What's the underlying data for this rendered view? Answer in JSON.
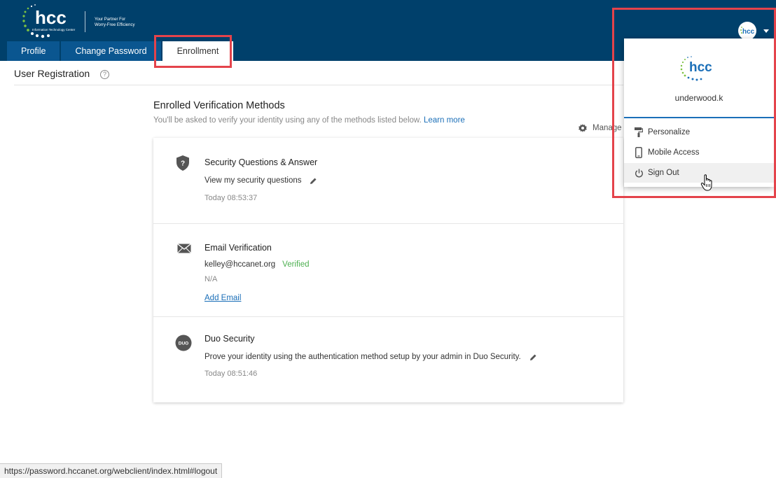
{
  "brand": {
    "logo_text": "hcc",
    "logo_subtext": "Information Technology Center",
    "tagline_line1": "Your Partner For",
    "tagline_line2": "Worry-Free Efficiency",
    "header_color": "#00406b",
    "accent_color": "#1b6fb8"
  },
  "tabs": [
    {
      "label": "Profile",
      "active": false
    },
    {
      "label": "Change Password",
      "active": false
    },
    {
      "label": "Enrollment",
      "active": true
    }
  ],
  "page": {
    "title": "User Registration",
    "help_icon": "question-circle-icon"
  },
  "section": {
    "title": "Enrolled Verification Methods",
    "subtitle": "You'll be asked to verify your identity using any of the methods listed below.",
    "learn_more": "Learn more",
    "manage_label": "Manage"
  },
  "methods": [
    {
      "icon": "shield-question-icon",
      "name": "Security Questions & Answer",
      "detail": "View my security questions",
      "timestamp": "Today 08:53:37"
    },
    {
      "icon": "envelope-icon",
      "name": "Email Verification",
      "email": "kelley@hccanet.org",
      "status": "Verified",
      "secondary": "N/A",
      "add_link": "Add Email"
    },
    {
      "icon": "duo-icon",
      "name": "Duo Security",
      "detail": "Prove your identity using the authentication method setup by your admin in Duo Security.",
      "timestamp": "Today 08:51:46"
    }
  ],
  "user_menu": {
    "username": "underwood.k",
    "items": [
      {
        "label": "Personalize",
        "icon": "paint-roller-icon"
      },
      {
        "label": "Mobile Access",
        "icon": "mobile-phone-icon"
      },
      {
        "label": "Sign Out",
        "icon": "power-icon"
      }
    ]
  },
  "status_bar": {
    "url": "https://password.hccanet.org/webclient/index.html#logout"
  }
}
